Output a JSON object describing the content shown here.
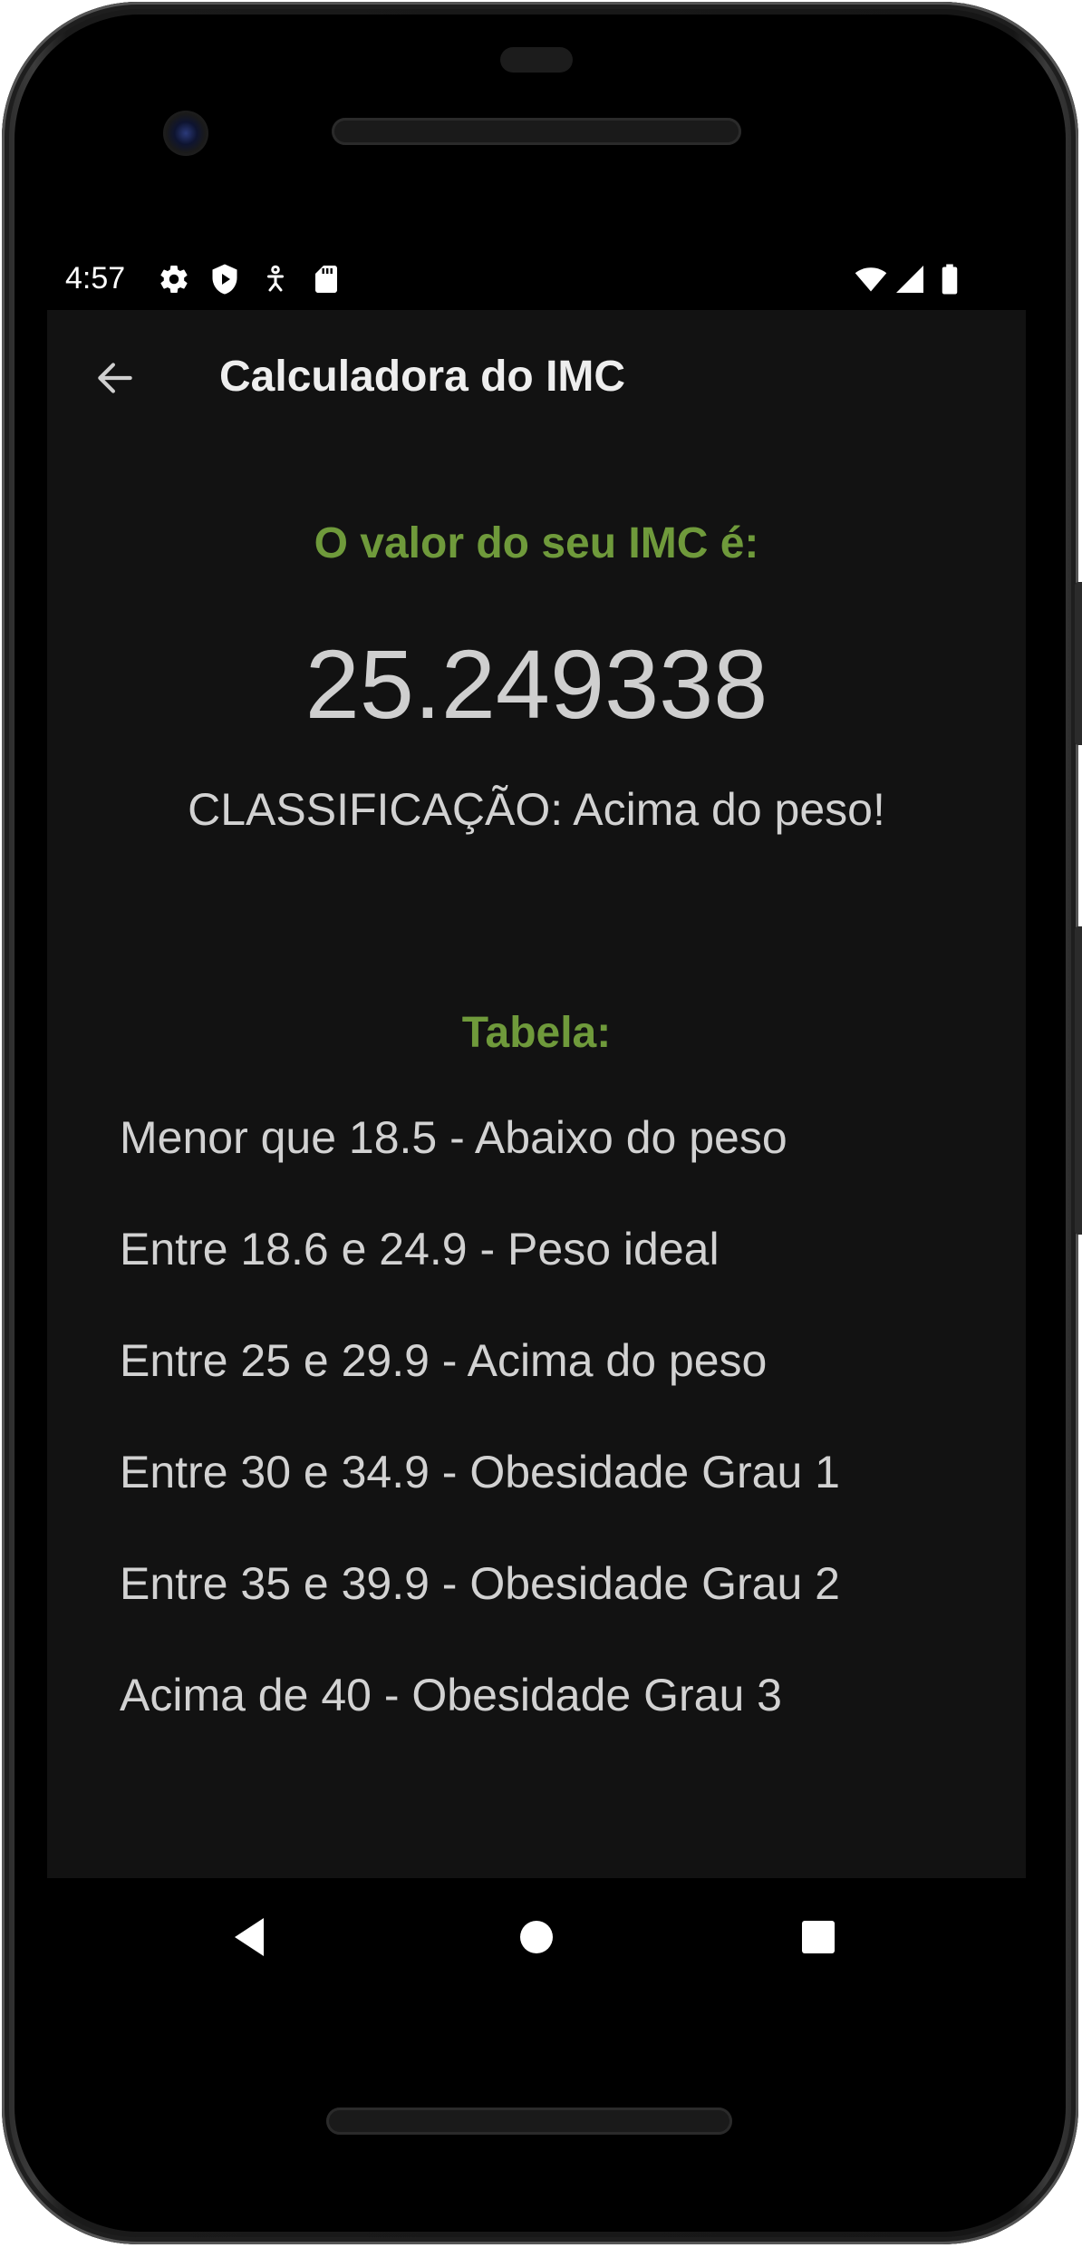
{
  "status_bar": {
    "time": "4:57",
    "icons": [
      "gear-icon",
      "shield-play-icon",
      "accessibility-icon",
      "sd-card-icon",
      "wifi-icon",
      "signal-icon",
      "battery-icon"
    ]
  },
  "app_bar": {
    "title": "Calculadora do IMC",
    "back_icon": "arrow-back-icon"
  },
  "result": {
    "label": "O valor do seu IMC é:",
    "value": "25.249338",
    "classification": "CLASSIFICAÇÃO: Acima do peso!"
  },
  "table": {
    "title": "Tabela:",
    "rows": [
      "Menor que 18.5 - Abaixo do peso",
      "Entre 18.6 e 24.9 - Peso ideal",
      "Entre 25 e 29.9 - Acima do peso",
      "Entre 30 e 34.9 - Obesidade Grau 1",
      "Entre 35 e 39.9 - Obesidade Grau 2",
      "Acima de 40 - Obesidade Grau 3"
    ]
  },
  "nav_bar": {
    "buttons": [
      "back-triangle-icon",
      "home-circle-icon",
      "recents-square-icon"
    ]
  },
  "colors": {
    "accent": "#6f9a3b",
    "background": "#121212",
    "text": "#d2d2d2"
  }
}
